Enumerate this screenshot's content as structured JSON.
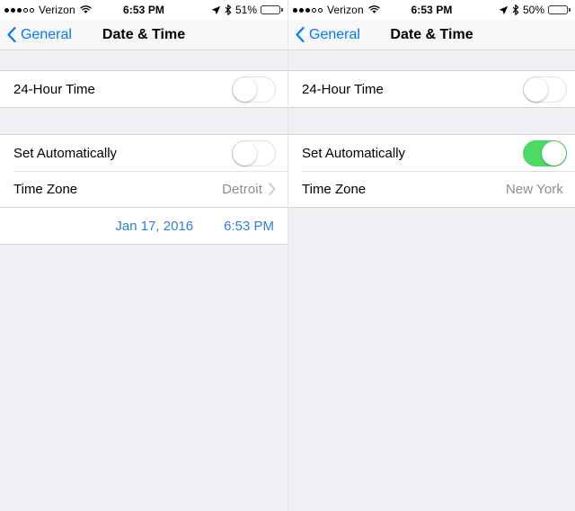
{
  "panels": [
    {
      "status": {
        "signal_filled": 3,
        "signal_hollow": 2,
        "carrier": "Verizon",
        "wifi_icon": "wifi-icon",
        "time": "6:53 PM",
        "location_icon": "location-arrow-icon",
        "bluetooth_icon": "bluetooth-icon",
        "battery_percent": "51%",
        "battery_level": 51
      },
      "nav": {
        "back_label": "General",
        "back_icon": "chevron-left-icon",
        "title": "Date & Time"
      },
      "section_one": {
        "rows": [
          {
            "label": "24-Hour Time",
            "type": "toggle",
            "toggle_on": false
          }
        ]
      },
      "section_two": {
        "rows": [
          {
            "label": "Set Automatically",
            "type": "toggle",
            "toggle_on": false
          },
          {
            "label": "Time Zone",
            "type": "value",
            "value": "Detroit",
            "chevron": true
          }
        ]
      },
      "section_three": {
        "date": "Jan 17, 2016",
        "time": "6:53 PM"
      }
    },
    {
      "status": {
        "signal_filled": 3,
        "signal_hollow": 2,
        "carrier": "Verizon",
        "wifi_icon": "wifi-icon",
        "time": "6:53 PM",
        "location_icon": "location-arrow-icon",
        "bluetooth_icon": "bluetooth-icon",
        "battery_percent": "50%",
        "battery_level": 50
      },
      "nav": {
        "back_label": "General",
        "back_icon": "chevron-left-icon",
        "title": "Date & Time"
      },
      "section_one": {
        "rows": [
          {
            "label": "24-Hour Time",
            "type": "toggle",
            "toggle_on": false
          }
        ]
      },
      "section_two": {
        "rows": [
          {
            "label": "Set Automatically",
            "type": "toggle",
            "toggle_on": true
          },
          {
            "label": "Time Zone",
            "type": "value",
            "value": "New York",
            "chevron": false
          }
        ]
      },
      "section_three": null
    }
  ],
  "colors": {
    "accent_blue": "#007AFF",
    "date_blue": "#2f7fe0",
    "toggle_on_green": "#4CD964",
    "group_background": "#EFEFF4",
    "row_background": "#FFFFFF",
    "value_gray": "#8E8E93"
  }
}
